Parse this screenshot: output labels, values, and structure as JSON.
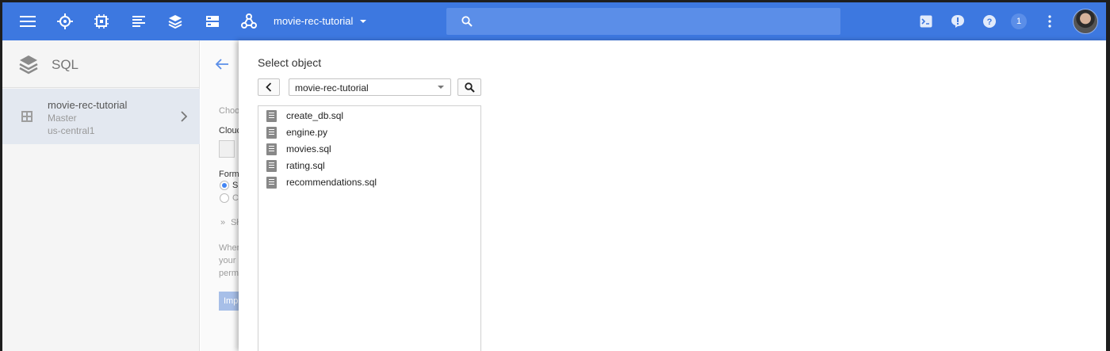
{
  "topbar": {
    "project": "movie-rec-tutorial",
    "notification_count": "1",
    "icons": [
      "menu-icon",
      "dashboard-icon",
      "compute-icon",
      "list-icon",
      "stack-icon",
      "storage-icon",
      "network-icon",
      "search-icon",
      "terminal-icon",
      "alert-icon",
      "help-icon",
      "more-icon"
    ]
  },
  "sidebar": {
    "title": "SQL",
    "instance": {
      "name": "movie-rec-tutorial",
      "role": "Master",
      "region": "us-central1"
    }
  },
  "background_form": {
    "choose": "Choo",
    "cloud": "Clouc",
    "format": "Form",
    "option1": "S",
    "option2": "C",
    "show": "Sł",
    "help1": "Wher",
    "help2": "your",
    "help3": "perm",
    "button": "Imp"
  },
  "dialog": {
    "title": "Select object",
    "bucket": "movie-rec-tutorial",
    "files": [
      "create_db.sql",
      "engine.py",
      "movies.sql",
      "rating.sql",
      "recommendations.sql"
    ]
  },
  "colors": {
    "topbar": "#3d78e0",
    "search": "#5b8ee8",
    "selection": "#e3e8f0"
  }
}
